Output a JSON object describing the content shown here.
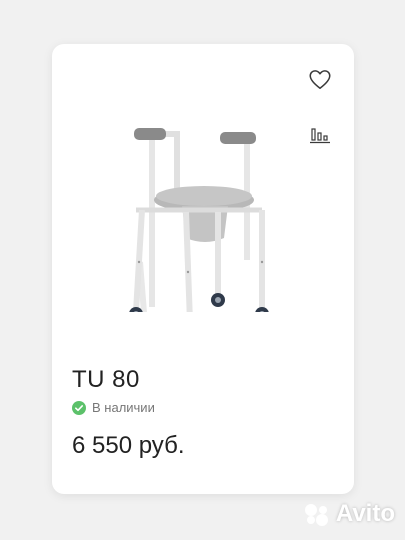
{
  "product": {
    "title": "TU 80",
    "availability": "В наличии",
    "price": "6 550 руб."
  },
  "icons": {
    "favorite": "heart-icon",
    "compare": "compare-icon",
    "availability": "check-circle-icon"
  },
  "colors": {
    "accent_green": "#5cc16a",
    "card_bg": "#ffffff",
    "page_bg": "#f1f1f1"
  },
  "watermark": {
    "text": "Avito"
  }
}
